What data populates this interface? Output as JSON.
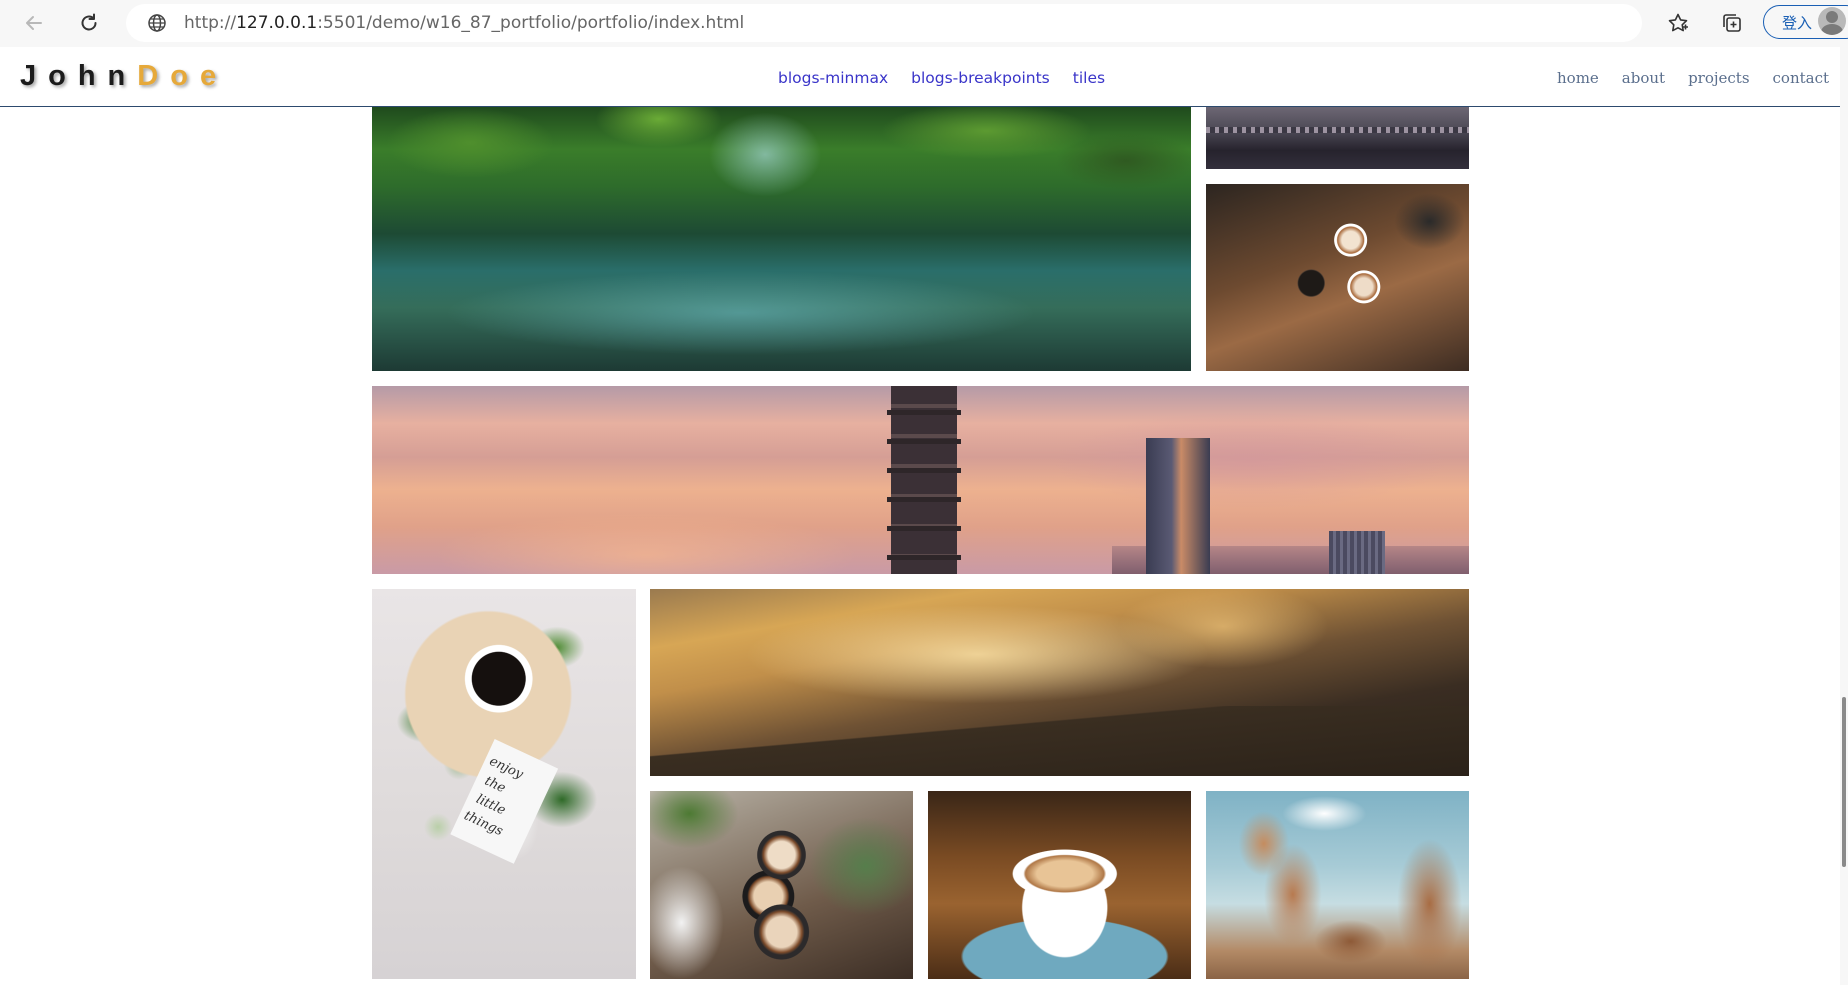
{
  "browser": {
    "url_prefix": "http://",
    "url_host": "127.0.0.1",
    "url_rest": ":5501/demo/w16_87_portfolio/portfolio/index.html",
    "signin_label": "登入",
    "icons": [
      "back-arrow-icon",
      "reload-icon",
      "site-info-icon",
      "favorite-star-icon",
      "collections-icon",
      "profile-avatar-icon"
    ]
  },
  "site": {
    "logo_first": "John",
    "logo_last": "Doe",
    "center_nav": [
      "blogs-minmax",
      "blogs-breakpoints",
      "tiles"
    ],
    "right_nav": [
      "home",
      "about",
      "projects",
      "contact"
    ]
  },
  "colors": {
    "accent_link": "#3a35c9",
    "logo_last": "#e6a93a",
    "right_nav": "#5b6f8d",
    "header_border": "#2d4a6e"
  },
  "gallery": {
    "tiles": [
      "forest-river",
      "bridge-night",
      "coffee-cheers",
      "taipei-skyline",
      "coffee-table-flatlay",
      "mountain-sunset",
      "latte-plants",
      "latte-blue-saucer",
      "rock-formations"
    ],
    "coffee_card_text": "enjoy the little things"
  }
}
